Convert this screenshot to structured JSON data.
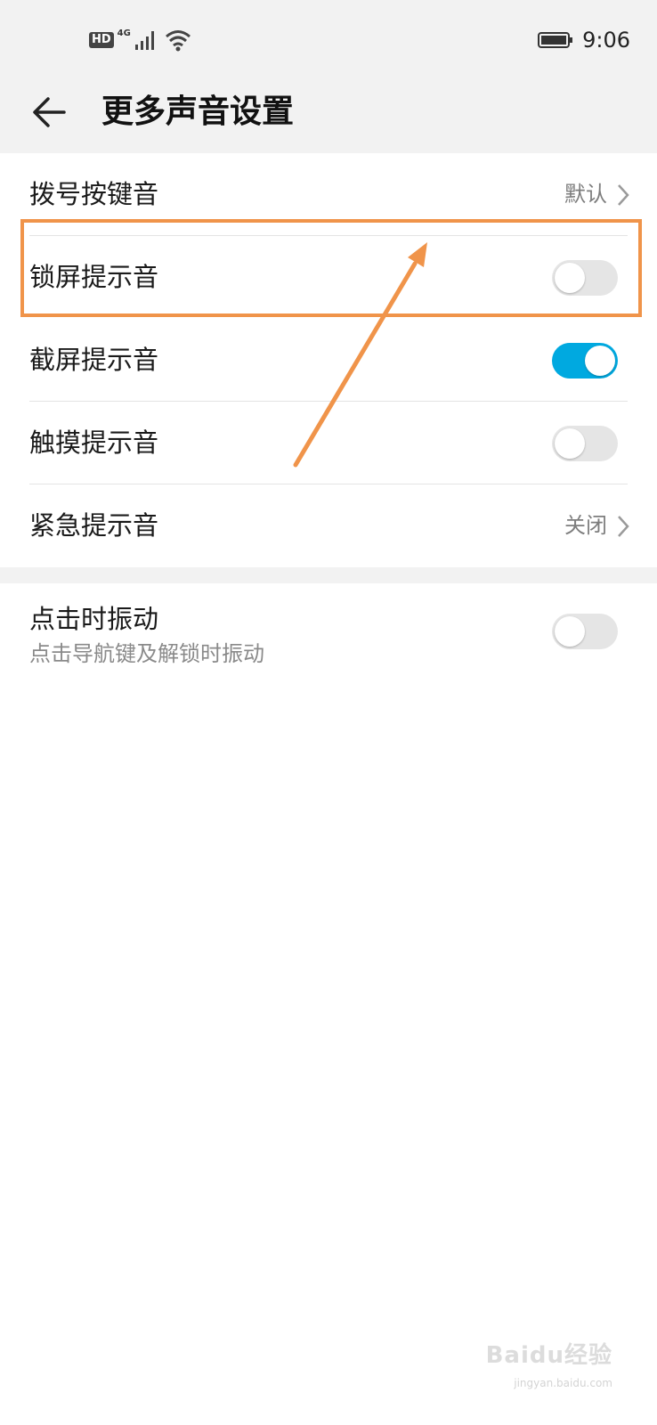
{
  "status_bar": {
    "hd_badge": "HD",
    "network_label": "4G",
    "time": "9:06",
    "icons": [
      "signal-icon",
      "wifi-icon",
      "battery-icon"
    ]
  },
  "header": {
    "back_icon": "back-arrow-icon",
    "title": "更多声音设置"
  },
  "settings": {
    "dial_pad": {
      "label": "拨号按键音",
      "value": "默认"
    },
    "lock_screen": {
      "label": "锁屏提示音",
      "enabled": false
    },
    "screenshot": {
      "label": "截屏提示音",
      "enabled": true
    },
    "touch": {
      "label": "触摸提示音",
      "enabled": false
    },
    "emergency": {
      "label": "紧急提示音",
      "value": "关闭"
    },
    "vibrate_on_tap": {
      "label": "点击时振动",
      "description": "点击导航键及解锁时振动",
      "enabled": false
    }
  },
  "annotation": {
    "highlight_color": "#f0944a",
    "highlighted_row": "锁屏提示音"
  },
  "colors": {
    "toggle_on": "#00a9e0",
    "toggle_off": "#e5e5e5",
    "header_bg": "#f2f2f2"
  },
  "watermark": {
    "text": "Baidu经验",
    "sub": "jingyan.baidu.com"
  }
}
